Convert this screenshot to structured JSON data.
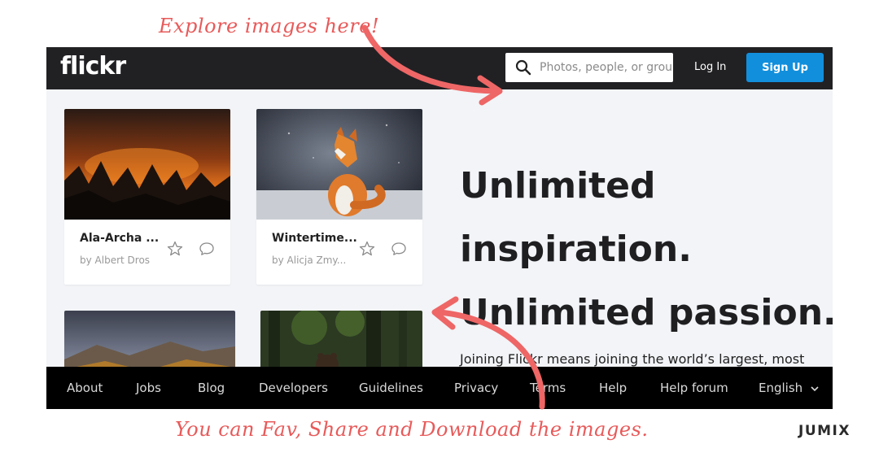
{
  "annotations": {
    "top": "Explore images here!",
    "bottom": "You can Fav, Share and Download the images.",
    "watermark": "JUMIX"
  },
  "header": {
    "logo": "flickr",
    "search_placeholder": "Photos, people, or groups",
    "login_label": "Log In",
    "signup_label": "Sign Up"
  },
  "cards": [
    {
      "title": "Ala-Archa ...",
      "author": "by Albert Dros",
      "icon": "mountain-fire-photo"
    },
    {
      "title": "Wintertime...",
      "author": "by Alicja Zmy...",
      "icon": "fox-photo"
    }
  ],
  "hero": {
    "line1": "Unlimited",
    "line2": "inspiration.",
    "line3": "Unlimited passion.",
    "subtext": "Joining Flickr means joining the world’s largest, most"
  },
  "footer": {
    "links": [
      "About",
      "Jobs",
      "Blog",
      "Developers",
      "Guidelines",
      "Privacy",
      "Terms",
      "Help",
      "Help forum"
    ],
    "language": "English"
  },
  "colors": {
    "annotation": "#e85a5a",
    "topbar": "#212124",
    "signup": "#128fdc",
    "footer": "#000000",
    "page_bg": "#f2f4f7"
  }
}
